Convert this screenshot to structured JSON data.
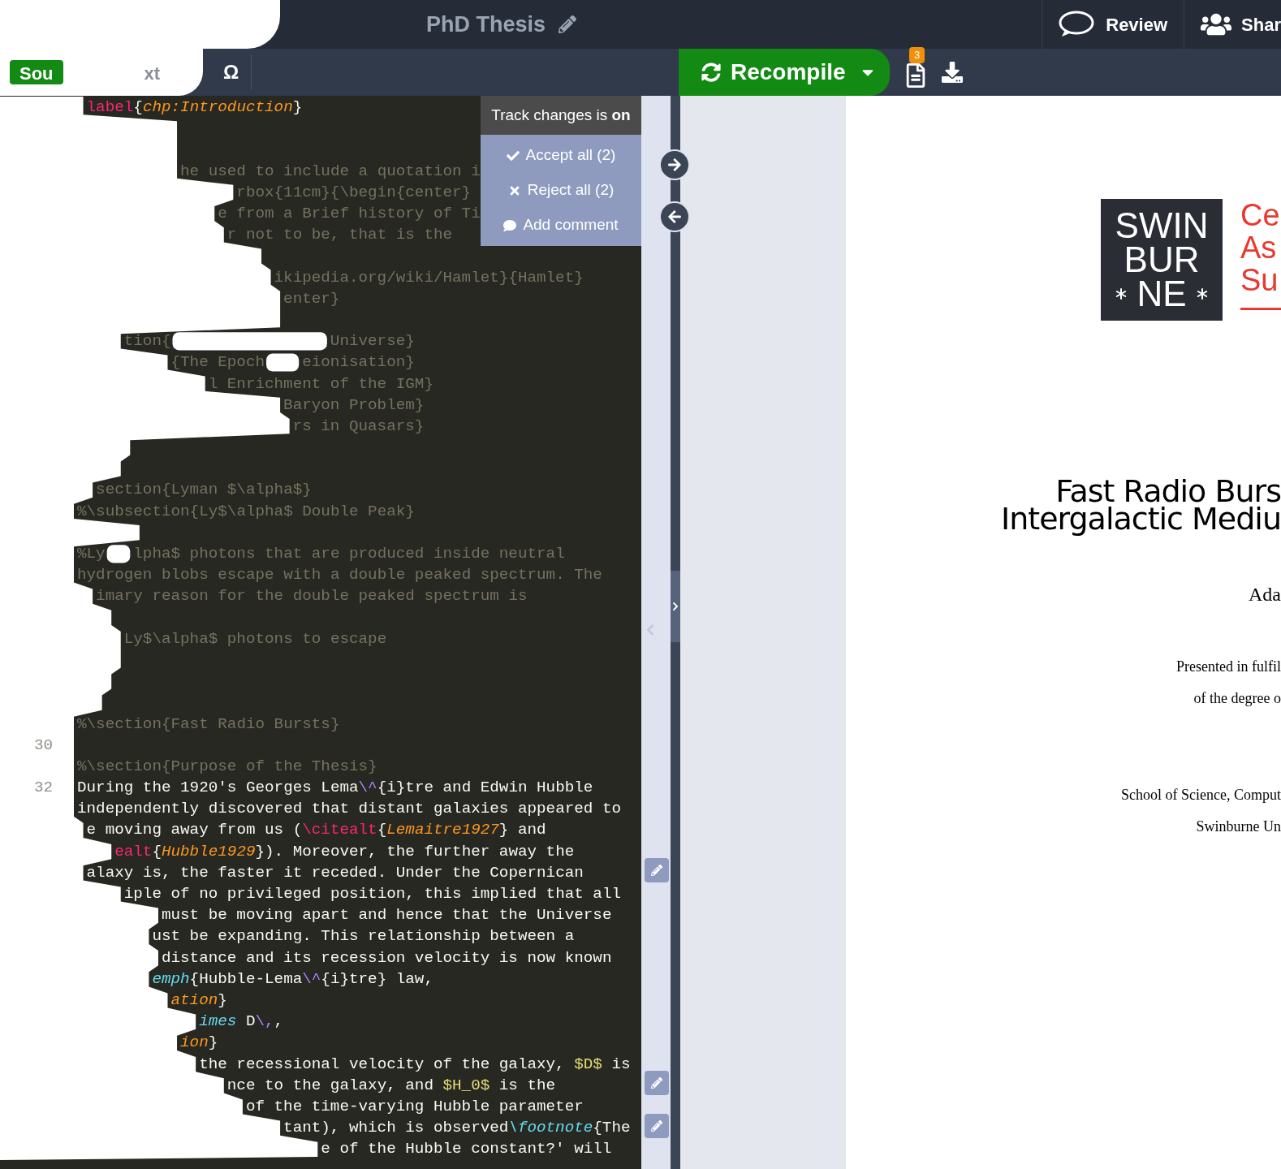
{
  "header": {
    "title": "PhD Thesis",
    "review": "Review",
    "share": "Shar"
  },
  "toolbar": {
    "tabs": [
      {
        "label": "Sou",
        "selected": true
      },
      {
        "label": "xt",
        "selected": false
      }
    ],
    "symbol": "Ω",
    "recompile": "Recompile",
    "log_badge": "3"
  },
  "track_changes": {
    "status": "Track changes is **on**",
    "actions": [
      "Accept all (2)",
      "Reject all (2)",
      "Add comment"
    ]
  },
  "editor": {
    "lines": [
      {
        "kind": "code",
        "fragments": [
          [
            {
              "kind": "command",
              "text": "label"
            },
            {
              "kind": "plain",
              "text": "{"
            },
            {
              "kind": "argument",
              "text": "chp:Introduction"
            },
            {
              "kind": "plain",
              "text": "}"
            }
          ]
        ]
      },
      {
        "kind": "blank"
      },
      {
        "kind": "blank"
      },
      {
        "kind": "comment",
        "fragments": [
          [
            {
              "kind": "plain",
              "text": "he used to include a quotation i"
            }
          ]
        ]
      },
      {
        "kind": "comment",
        "fragments": [
          [
            {
              "kind": "plain",
              "text": "rbox{11cm}{\\begin{center}"
            }
          ]
        ]
      },
      {
        "kind": "comment",
        "fragments": [
          [
            {
              "kind": "plain",
              "text": "e from a Brief history of Ti"
            }
          ]
        ]
      },
      {
        "kind": "comment",
        "fragments": [
          [
            {
              "kind": "plain",
              "text": "r not to be, that is the"
            }
          ]
        ]
      },
      {
        "kind": "blank"
      },
      {
        "kind": "comment",
        "fragments": [
          [
            {
              "kind": "plain",
              "text": "ikipedia.org/wiki/Hamlet}{Hamlet}"
            }
          ]
        ]
      },
      {
        "kind": "comment",
        "fragments": [
          [
            {
              "kind": "plain",
              "text": "enter}"
            }
          ]
        ]
      },
      {
        "kind": "blank"
      },
      {
        "kind": "comment",
        "fragments": [
          [
            {
              "kind": "plain",
              "text": "tion{"
            }
          ],
          [
            {
              "kind": "plain",
              "text": "Universe}"
            }
          ]
        ]
      },
      {
        "kind": "comment",
        "fragments": [
          [
            {
              "kind": "plain",
              "text": "{The Epoch"
            }
          ],
          [
            {
              "kind": "plain",
              "text": "eionisation}"
            }
          ]
        ]
      },
      {
        "kind": "comment",
        "fragments": [
          [
            {
              "kind": "plain",
              "text": "l Enrichment of the IGM}"
            }
          ]
        ]
      },
      {
        "kind": "comment",
        "fragments": [
          [
            {
              "kind": "plain",
              "text": "Baryon Problem}"
            }
          ]
        ]
      },
      {
        "kind": "comment",
        "fragments": [
          [
            {
              "kind": "plain",
              "text": "rs in Quasars}"
            }
          ]
        ]
      },
      {
        "kind": "blank"
      },
      {
        "kind": "blank"
      },
      {
        "kind": "comment",
        "fragments": [
          [
            {
              "kind": "plain",
              "text": "section{Lyman $\\alpha$}"
            }
          ]
        ]
      },
      {
        "kind": "comment",
        "fragments": [
          [
            {
              "kind": "plain",
              "text": "%\\subsection{Ly$\\alpha$ Double Peak}"
            }
          ]
        ]
      },
      {
        "kind": "blank"
      },
      {
        "kind": "comment",
        "fragments": [
          [
            {
              "kind": "plain",
              "text": "%Ly"
            }
          ],
          [
            {
              "kind": "plain",
              "text": "lpha$ photons that are produced inside neutral"
            }
          ]
        ]
      },
      {
        "kind": "comment",
        "fragments": [
          [
            {
              "kind": "plain",
              "text": "hydrogen blobs escape with a double peaked spectrum. The"
            }
          ]
        ]
      },
      {
        "kind": "comment",
        "fragments": [
          [
            {
              "kind": "plain",
              "text": "imary reason for the double peaked spectrum is"
            }
          ]
        ]
      },
      {
        "kind": "blank"
      },
      {
        "kind": "comment",
        "fragments": [
          [
            {
              "kind": "plain",
              "text": "Ly$\\alpha$ photons to escape"
            }
          ]
        ]
      },
      {
        "kind": "blank"
      },
      {
        "kind": "blank"
      },
      {
        "kind": "blank"
      },
      {
        "kind": "comment",
        "fragments": [
          [
            {
              "kind": "plain",
              "text": "%\\section{Fast Radio Bursts}"
            }
          ]
        ]
      },
      {
        "number": "30"
      },
      {
        "kind": "comment",
        "fragments": [
          [
            {
              "kind": "plain",
              "text": "%\\section{Purpose of the Thesis}"
            }
          ]
        ]
      },
      {
        "kind": "code",
        "number": "32",
        "fragments": [
          [
            {
              "kind": "plain",
              "text": "During the 1920's Georges Lema"
            },
            {
              "kind": "escape",
              "text": "\\^"
            },
            {
              "kind": "plain",
              "text": "{i}tre and Edwin Hubble"
            }
          ]
        ]
      },
      {
        "kind": "code",
        "fragments": [
          [
            {
              "kind": "plain",
              "text": "independently discovered that distant galaxies appeared to"
            }
          ]
        ]
      },
      {
        "kind": "code",
        "fragments": [
          [
            {
              "kind": "plain",
              "text": "e moving away from us ("
            },
            {
              "kind": "command",
              "text": "\\citealt"
            },
            {
              "kind": "plain",
              "text": "{"
            },
            {
              "kind": "argument",
              "text": "Lemaitre1927"
            },
            {
              "kind": "plain",
              "text": "} and"
            }
          ]
        ]
      },
      {
        "kind": "code",
        "fragments": [
          [
            {
              "kind": "command",
              "text": "ealt"
            },
            {
              "kind": "plain",
              "text": "{"
            },
            {
              "kind": "argument",
              "text": "Hubble1929"
            },
            {
              "kind": "plain",
              "text": "}). Moreover, the further away the"
            }
          ]
        ]
      },
      {
        "kind": "code",
        "fragments": [
          [
            {
              "kind": "plain",
              "text": "alaxy is, the faster it receded. Under the Copernican"
            }
          ]
        ]
      },
      {
        "kind": "code",
        "fragments": [
          [
            {
              "kind": "plain",
              "text": "iple of no privileged position, this implied that all"
            }
          ]
        ]
      },
      {
        "kind": "code",
        "fragments": [
          [
            {
              "kind": "plain",
              "text": "must be moving apart and hence that the Universe"
            }
          ]
        ]
      },
      {
        "kind": "code",
        "fragments": [
          [
            {
              "kind": "plain",
              "text": "ust be expanding. This relationship between a"
            }
          ]
        ]
      },
      {
        "kind": "code",
        "fragments": [
          [
            {
              "kind": "plain",
              "text": "distance and its recession velocity is now known"
            }
          ]
        ]
      },
      {
        "kind": "code",
        "fragments": [
          [
            {
              "kind": "emph",
              "text": "emph"
            },
            {
              "kind": "plain",
              "text": "{Hubble-Lema"
            },
            {
              "kind": "escape",
              "text": "\\^"
            },
            {
              "kind": "plain",
              "text": "{i}tre} law,"
            }
          ]
        ]
      },
      {
        "kind": "code",
        "fragments": [
          [
            {
              "kind": "argument",
              "text": "ation"
            },
            {
              "kind": "plain",
              "text": "}"
            }
          ]
        ]
      },
      {
        "kind": "code",
        "fragments": [
          [
            {
              "kind": "emph",
              "text": "imes"
            },
            {
              "kind": "plain",
              "text": " D"
            },
            {
              "kind": "escape",
              "text": "\\,"
            },
            {
              "kind": "plain",
              "text": ","
            }
          ]
        ]
      },
      {
        "kind": "code",
        "fragments": [
          [
            {
              "kind": "argument",
              "text": "ion"
            },
            {
              "kind": "plain",
              "text": "}"
            }
          ]
        ]
      },
      {
        "kind": "code",
        "fragments": [
          [
            {
              "kind": "plain",
              "text": "the recessional velocity of the galaxy, "
            },
            {
              "kind": "math",
              "text": "$D$"
            },
            {
              "kind": "plain",
              "text": " is"
            }
          ]
        ]
      },
      {
        "kind": "code",
        "fragments": [
          [
            {
              "kind": "plain",
              "text": "nce to the galaxy, and "
            },
            {
              "kind": "math",
              "text": "$H_0$"
            },
            {
              "kind": "plain",
              "text": " is the"
            }
          ]
        ]
      },
      {
        "kind": "code",
        "fragments": [
          [
            {
              "kind": "plain",
              "text": "of the time-varying Hubble parameter"
            }
          ]
        ]
      },
      {
        "kind": "code",
        "fragments": [
          [
            {
              "kind": "plain",
              "text": "tant), which is observed"
            },
            {
              "kind": "emph",
              "text": "\\footnote"
            },
            {
              "kind": "plain",
              "text": "{The"
            }
          ]
        ]
      },
      {
        "kind": "code",
        "fragments": [
          [
            {
              "kind": "plain",
              "text": "e of the Hubble constant?' will"
            }
          ]
        ]
      }
    ]
  },
  "pdf": {
    "logo": [
      "SWIN",
      "BUR",
      "NE"
    ],
    "logo_side": [
      "Ce",
      "As",
      "Su"
    ],
    "title": [
      "Fast Radio Burs",
      "Intergalactic Mediu"
    ],
    "author": "Ada",
    "presented": [
      "Presented in fulfil",
      "of the degree o"
    ],
    "school": [
      "School of Science, Comput",
      "Swinburne Un"
    ]
  }
}
